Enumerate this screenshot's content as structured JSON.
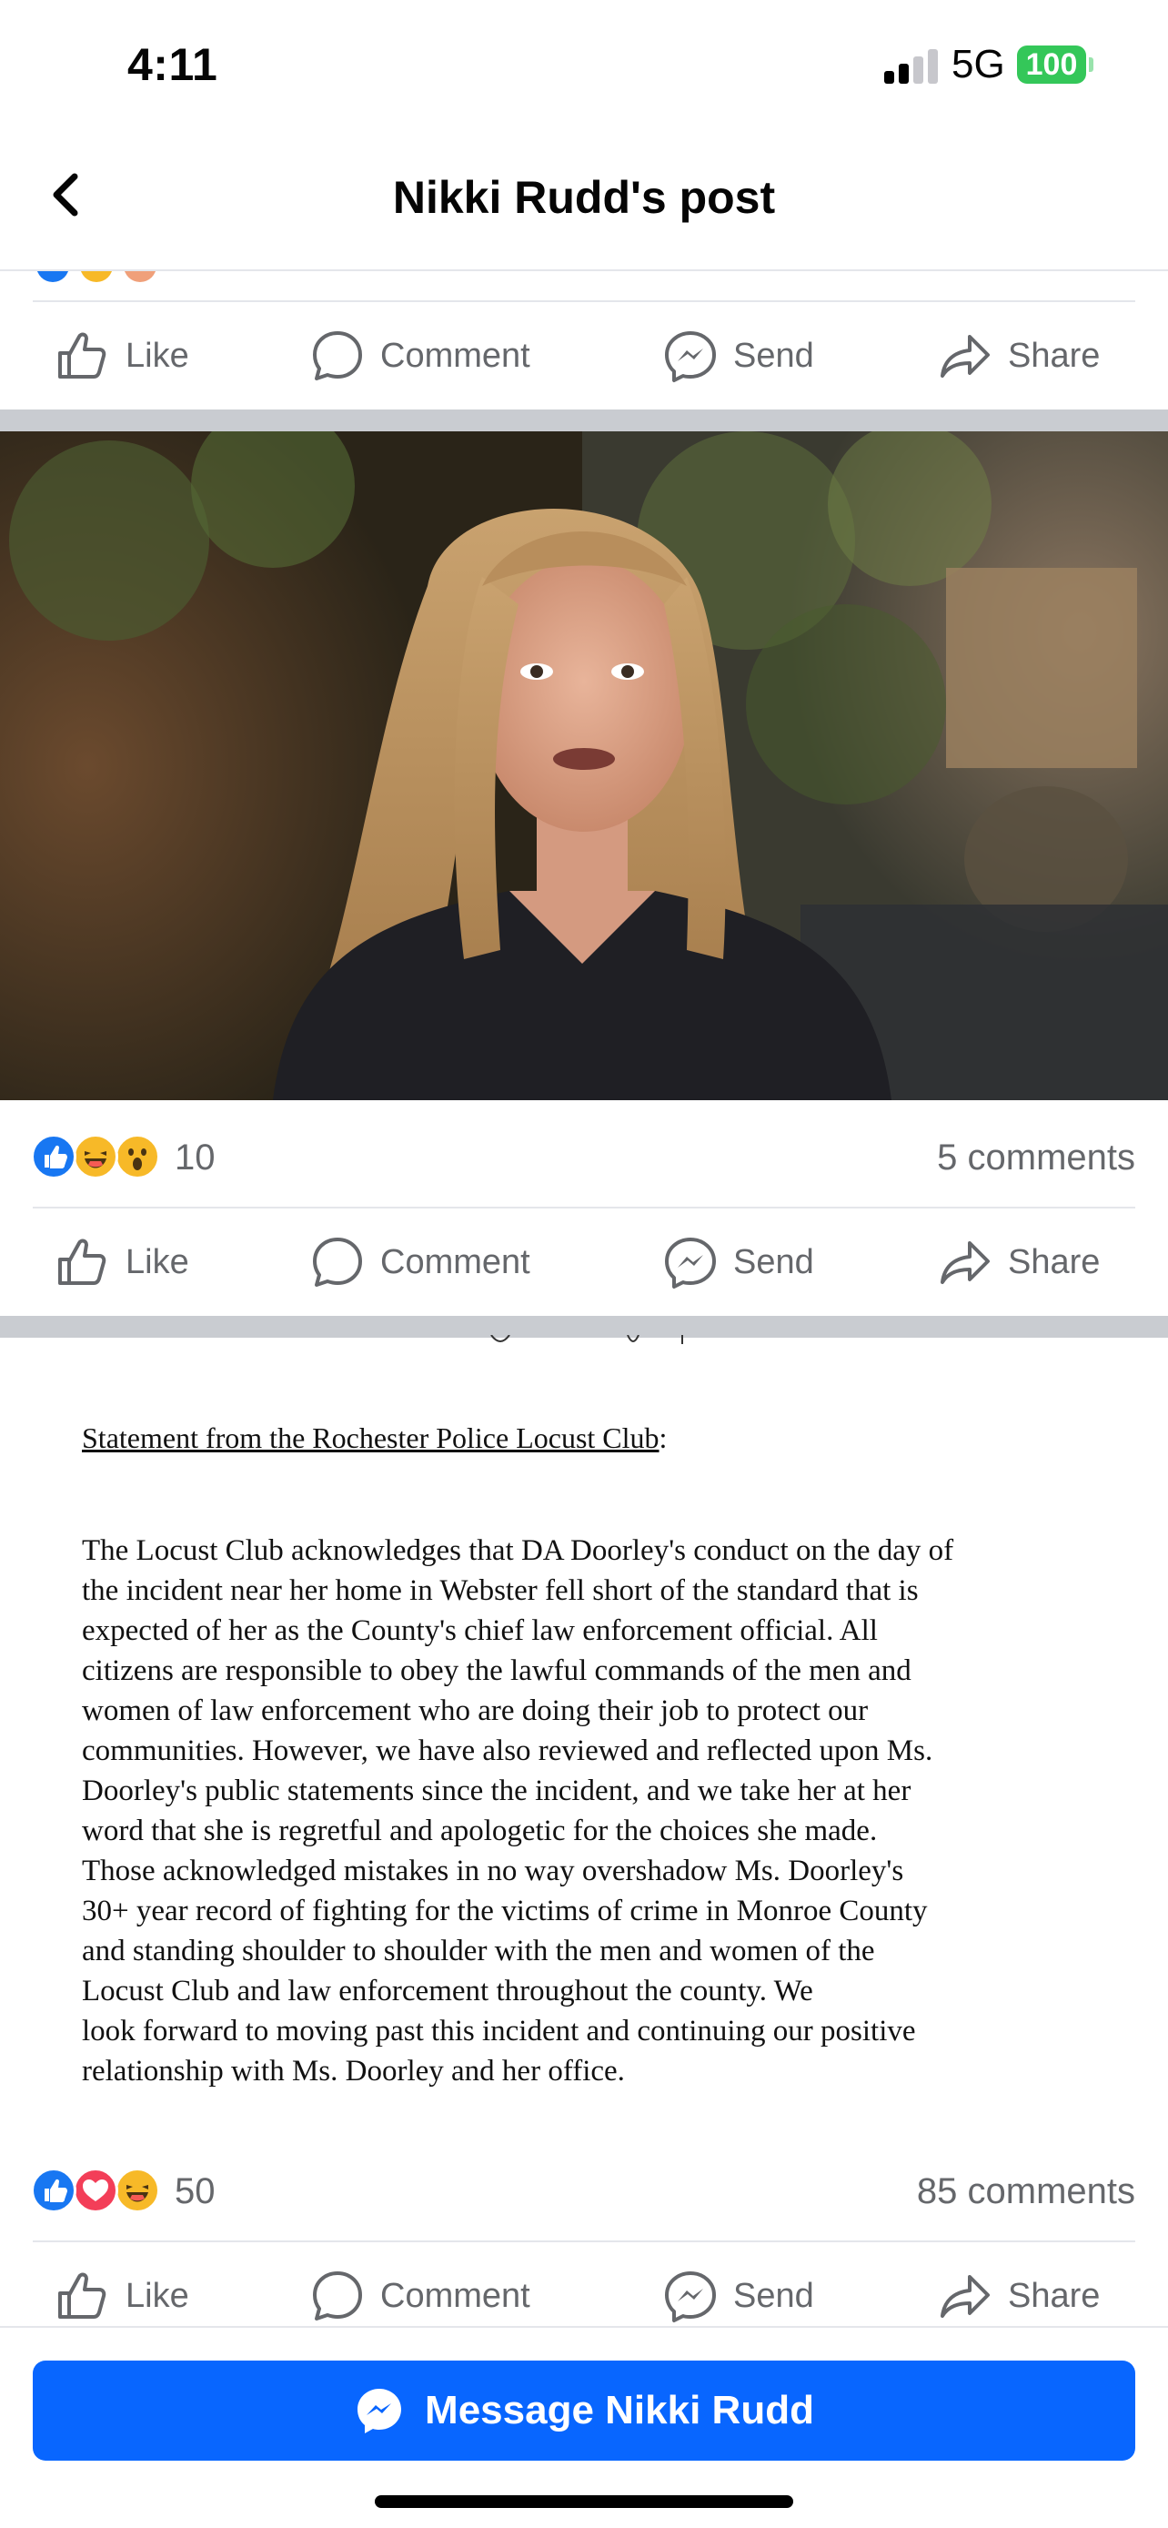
{
  "status_bar": {
    "time": "4:11",
    "network": "5G",
    "battery": "100"
  },
  "nav": {
    "title": "Nikki Rudd's post"
  },
  "actions": {
    "like": "Like",
    "comment": "Comment",
    "send": "Send",
    "share": "Share"
  },
  "posts": [
    {
      "media": "video-thumbnail-woman-speaking",
      "reactions": [
        "like",
        "haha",
        "wow"
      ],
      "reaction_count": "10",
      "comments": "5 comments"
    },
    {
      "media": "document-image",
      "reactions": [
        "like",
        "love",
        "haha"
      ],
      "reaction_count": "50",
      "comments": "85 comments"
    }
  ],
  "document": {
    "heading": "Statement from the Rochester Police Locust Club",
    "heading_suffix": ":",
    "body": "The Locust Club acknowledges that DA Doorley's conduct on the day of\nthe incident near her home in Webster fell short of the standard that is\nexpected of her as the County's chief law enforcement official.  All\ncitizens are responsible to obey the lawful commands of the men and\nwomen of law enforcement who are doing their job to protect our\ncommunities.  However, we have also reviewed and reflected upon Ms.\nDoorley's public statements since the incident, and we take her at her\nword that she is regretful and apologetic for the choices she made.\nThose acknowledged mistakes in no way overshadow Ms. Doorley's\n30+ year record of fighting for the victims of crime in Monroe County\nand standing shoulder to shoulder with the men and women of the\nLocust Club and law enforcement throughout the county.  We\nlook forward to moving past this incident and continuing our positive\nrelationship with Ms. Doorley and her office."
  },
  "message_button": {
    "label": "Message Nikki Rudd"
  },
  "colors": {
    "brand_blue": "#0866ff",
    "like_blue": "#1877f2",
    "love_red": "#f33e58",
    "haha_yellow": "#f7b928",
    "muted_text": "#65676b",
    "battery_green": "#34c759"
  }
}
